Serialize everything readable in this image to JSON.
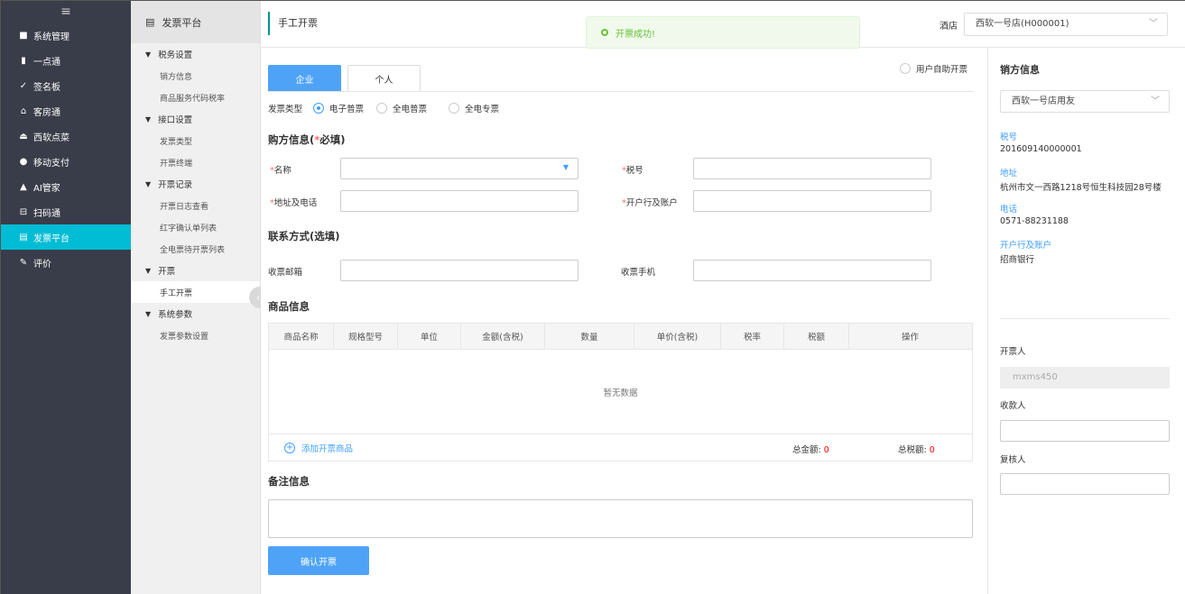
{
  "nav": {
    "items": [
      {
        "icon": "grid-icon",
        "glyph": "■",
        "label": "系统管理"
      },
      {
        "icon": "bar-chart-icon",
        "glyph": "▮",
        "label": "一点通"
      },
      {
        "icon": "pen-icon",
        "glyph": "✓",
        "label": "签名板"
      },
      {
        "icon": "home-icon",
        "glyph": "⌂",
        "label": "客房通"
      },
      {
        "icon": "eject-icon",
        "glyph": "⏏",
        "label": "西软点菜"
      },
      {
        "icon": "payment-icon",
        "glyph": "●",
        "label": "移动支付"
      },
      {
        "icon": "ai-icon",
        "glyph": "▲",
        "label": "AI管家"
      },
      {
        "icon": "scan-icon",
        "glyph": "⊟",
        "label": "扫码通"
      },
      {
        "icon": "invoice-icon",
        "glyph": "▤",
        "label": "发票平台"
      },
      {
        "icon": "edit-icon",
        "glyph": "✎",
        "label": "评价"
      }
    ]
  },
  "sub": {
    "title": "发票平台",
    "groups": [
      {
        "label": "税务设置",
        "links": [
          "销方信息",
          "商品服务代码税率"
        ]
      },
      {
        "label": "接口设置",
        "links": [
          "发票类型",
          "开票终端"
        ]
      },
      {
        "label": "开票记录",
        "links": [
          "开票日志查看",
          "红字确认单列表",
          "全电票待开票列表"
        ]
      },
      {
        "label": "开票",
        "links": [
          "手工开票"
        ]
      },
      {
        "label": "系统参数",
        "links": [
          "发票参数设置"
        ]
      }
    ]
  },
  "header": {
    "page_title": "手工开票",
    "hotel_label": "酒店",
    "hotel_value": "西软一号店(H000001)"
  },
  "toast": "开票成功!",
  "tabs": [
    "企业",
    "个人"
  ],
  "self_invoice_label": "用户自助开票",
  "invoice_type": {
    "label": "发票类型",
    "options": [
      "电子普票",
      "全电普票",
      "全电专票"
    ],
    "selected": 0
  },
  "buyer": {
    "title": "购方信息(",
    "title_star": "*",
    "title_suffix": "必填)",
    "name_label": "名称",
    "tax_label": "税号",
    "addr_label": "地址及电话",
    "bank_label": "开户行及账户"
  },
  "contact": {
    "title": "联系方式(选填)",
    "email_label": "收票邮箱",
    "phone_label": "收票手机"
  },
  "goods": {
    "title": "商品信息",
    "columns": [
      "商品名称",
      "规格型号",
      "单位",
      "金额(含税)",
      "数量",
      "单价(含税)",
      "税率",
      "税额",
      "操作"
    ],
    "empty": "暂无数据",
    "add_label": "添加开票商品",
    "total_amount_label": "总金额:",
    "total_amount": "0",
    "total_tax_label": "总税额:",
    "total_tax": "0"
  },
  "remark_title": "备注信息",
  "confirm_label": "确认开票",
  "seller": {
    "title": "销方信息",
    "select_value": "西软一号店用友",
    "fields": [
      {
        "key": "税号",
        "value": "201609140000001"
      },
      {
        "key": "地址",
        "value": "杭州市文一西路1218号恒生科技园28号楼"
      },
      {
        "key": "电话",
        "value": "0571-88231188"
      },
      {
        "key": "开户行及账户",
        "value": "招商银行"
      }
    ],
    "drawer_label": "开票人",
    "drawer_value": "mxms450",
    "payee_label": "收款人",
    "reviewer_label": "复核人"
  }
}
